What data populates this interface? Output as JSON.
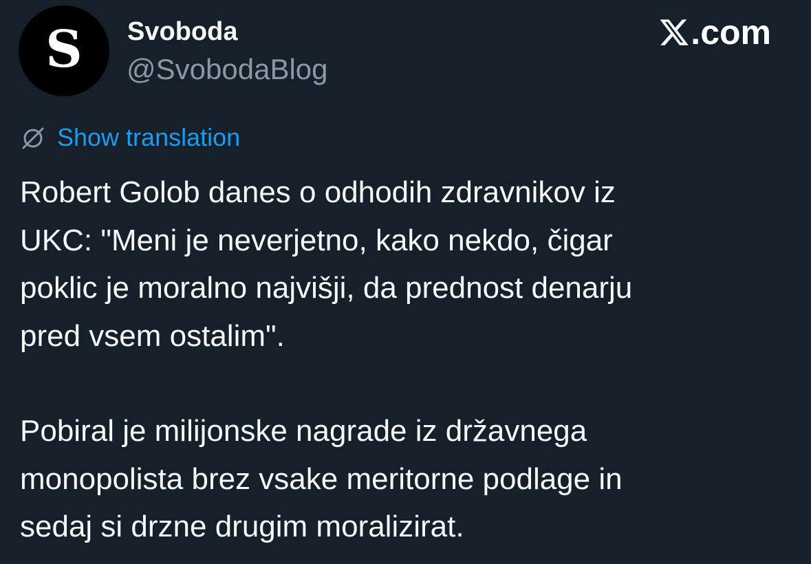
{
  "header": {
    "avatar_letter": "S",
    "display_name": "Svoboda",
    "handle": "@SvobodaBlog",
    "site": "X",
    "site_suffix": ".com"
  },
  "translation": {
    "icon": "globe-icon",
    "label": "Show translation"
  },
  "tweet": {
    "paragraph_1": "Robert Golob danes o odhodih zdravnikov iz\nUKC: \"Meni je neverjetno, kako nekdo, čigar\npoklic je moralno najvišji, da prednost denarju\npred vsem ostalim\".",
    "paragraph_2": "Pobiral je milijonske nagrade iz državnega\nmonopolista brez vsake meritorne podlage in\nsedaj si drzne drugim moralizirat."
  },
  "colors": {
    "background": "#15202b",
    "text": "#f7f9f9",
    "secondary_text": "#8b98a5",
    "link": "#1d9bf0"
  }
}
